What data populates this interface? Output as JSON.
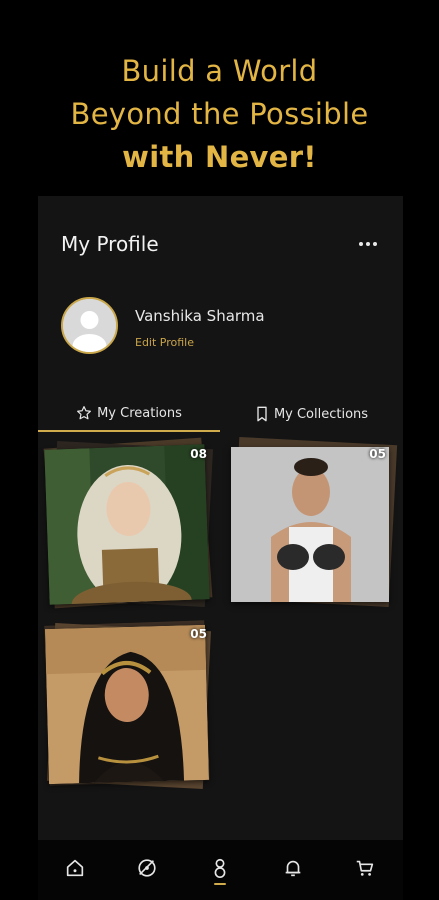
{
  "headline": {
    "line1": "Build a World",
    "line2": "Beyond the Possible",
    "line3": "with Never!"
  },
  "header": {
    "title": "My Profile",
    "menu_icon": "more-horizontal-icon"
  },
  "profile": {
    "name": "Vanshika Sharma",
    "edit_label": "Edit Profile",
    "avatar_icon": "default-avatar-icon"
  },
  "tabs": [
    {
      "label": "My Creations",
      "icon": "star-icon",
      "active": true
    },
    {
      "label": "My Collections",
      "icon": "bookmark-icon",
      "active": false
    }
  ],
  "creations": [
    {
      "count": "08",
      "subject": "fantasy-elf-portrait"
    },
    {
      "count": "05",
      "subject": "boxer-portrait"
    },
    {
      "count": "05",
      "subject": "desert-bride-portrait"
    }
  ],
  "bottom_nav": [
    {
      "icon": "home-icon",
      "active": false
    },
    {
      "icon": "explore-icon",
      "active": false
    },
    {
      "icon": "profile-icon",
      "active": true
    },
    {
      "icon": "bell-icon",
      "active": false
    },
    {
      "icon": "cart-icon",
      "active": false
    }
  ],
  "colors": {
    "accent": "#d1ac4d",
    "headline": "#e2b544",
    "background": "#000000",
    "panel": "#141414"
  }
}
